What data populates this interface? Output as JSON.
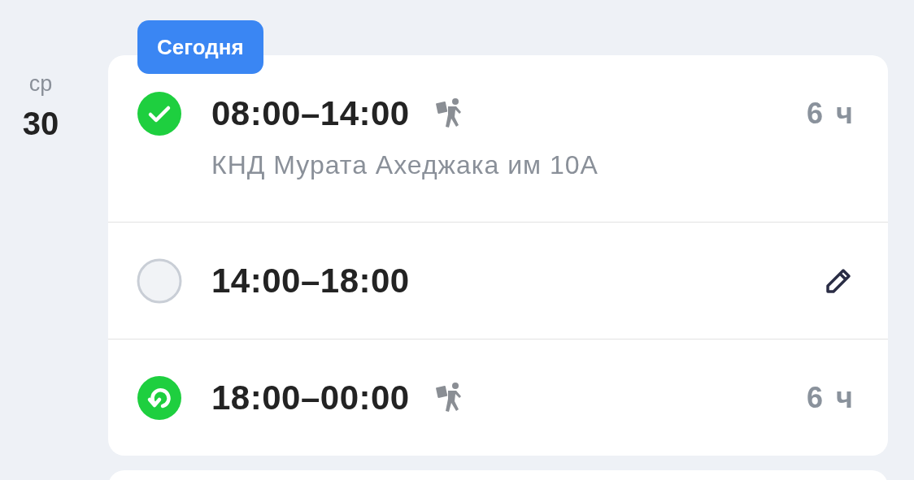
{
  "day": {
    "weekday": "ср",
    "date": "30"
  },
  "badge": "Сегодня",
  "shifts": [
    {
      "kind": "confirmed",
      "time": "08:00–14:00",
      "courier": true,
      "address": "КНД Мурата Ахеджака им 10А",
      "duration": "6 ч",
      "editable": false
    },
    {
      "kind": "empty",
      "time": "14:00–18:00",
      "courier": false,
      "editable": true
    },
    {
      "kind": "repeat",
      "time": "18:00–00:00",
      "courier": true,
      "duration": "6 ч",
      "editable": false
    }
  ]
}
